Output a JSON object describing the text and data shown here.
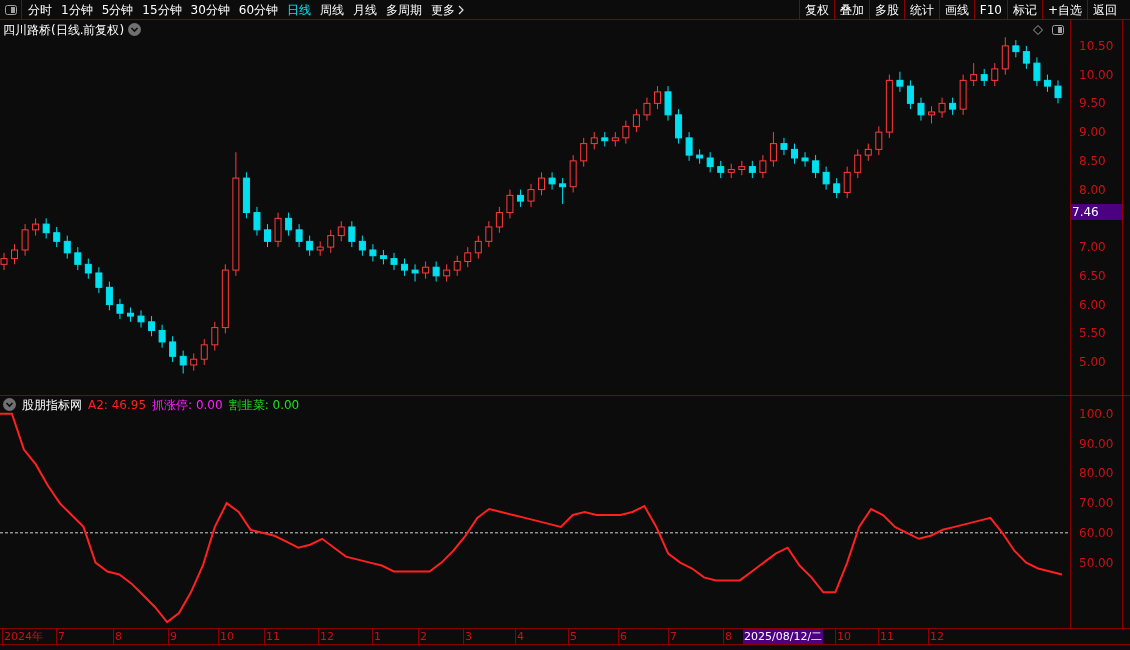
{
  "toolbar": {
    "periods": [
      {
        "label": "分时",
        "selected": false
      },
      {
        "label": "1分钟",
        "selected": false
      },
      {
        "label": "5分钟",
        "selected": false
      },
      {
        "label": "15分钟",
        "selected": false
      },
      {
        "label": "30分钟",
        "selected": false
      },
      {
        "label": "60分钟",
        "selected": false
      },
      {
        "label": "日线",
        "selected": true
      },
      {
        "label": "周线",
        "selected": false
      },
      {
        "label": "月线",
        "selected": false
      },
      {
        "label": "多周期",
        "selected": false
      },
      {
        "label": "更多",
        "selected": false
      }
    ],
    "buttons": [
      "复权",
      "叠加",
      "多股",
      "统计",
      "画线",
      "F10",
      "标记",
      "+自选",
      "返回"
    ]
  },
  "price_chart": {
    "title": "四川路桥(日线.前复权)",
    "current_price": "7.46",
    "chart_data": {
      "type": "candlestick",
      "ylim": [
        4.41,
        10.95
      ],
      "yticks": [
        {
          "value": 10.5,
          "label": "10.50"
        },
        {
          "value": 10,
          "label": "10.00"
        },
        {
          "value": 9.5,
          "label": "9.50"
        },
        {
          "value": 9,
          "label": "9.00"
        },
        {
          "value": 8.5,
          "label": "8.50"
        },
        {
          "value": 8,
          "label": "8.00"
        },
        {
          "value": 7,
          "label": "7.00"
        },
        {
          "value": 6.5,
          "label": "6.50"
        },
        {
          "value": 6,
          "label": "6.00"
        },
        {
          "value": 5.5,
          "label": "5.50"
        },
        {
          "value": 5,
          "label": "5.00"
        }
      ],
      "ohlc": [
        [
          6.7,
          6.9,
          6.6,
          6.8
        ],
        [
          6.8,
          7.05,
          6.7,
          6.95
        ],
        [
          6.95,
          7.4,
          6.85,
          7.3
        ],
        [
          7.3,
          7.5,
          7.2,
          7.4
        ],
        [
          7.4,
          7.5,
          7.15,
          7.25
        ],
        [
          7.25,
          7.35,
          7.0,
          7.1
        ],
        [
          7.1,
          7.2,
          6.8,
          6.9
        ],
        [
          6.9,
          7.0,
          6.6,
          6.7
        ],
        [
          6.7,
          6.8,
          6.45,
          6.55
        ],
        [
          6.55,
          6.65,
          6.2,
          6.3
        ],
        [
          6.3,
          6.4,
          5.9,
          6.0
        ],
        [
          6.0,
          6.1,
          5.75,
          5.85
        ],
        [
          5.85,
          5.95,
          5.7,
          5.8
        ],
        [
          5.8,
          5.9,
          5.6,
          5.7
        ],
        [
          5.7,
          5.8,
          5.45,
          5.55
        ],
        [
          5.55,
          5.65,
          5.25,
          5.35
        ],
        [
          5.35,
          5.45,
          5.0,
          5.1
        ],
        [
          5.1,
          5.2,
          4.8,
          4.95
        ],
        [
          4.95,
          5.15,
          4.85,
          5.05
        ],
        [
          5.05,
          5.4,
          4.95,
          5.3
        ],
        [
          5.3,
          5.7,
          5.2,
          5.6
        ],
        [
          5.6,
          6.7,
          5.5,
          6.6
        ],
        [
          6.6,
          8.65,
          6.5,
          8.2
        ],
        [
          8.2,
          8.3,
          7.5,
          7.6
        ],
        [
          7.6,
          7.7,
          7.2,
          7.3
        ],
        [
          7.3,
          7.4,
          7.0,
          7.1
        ],
        [
          7.1,
          7.6,
          7.0,
          7.5
        ],
        [
          7.5,
          7.6,
          7.2,
          7.3
        ],
        [
          7.3,
          7.4,
          7.0,
          7.1
        ],
        [
          7.1,
          7.2,
          6.85,
          6.95
        ],
        [
          6.95,
          7.1,
          6.85,
          7.0
        ],
        [
          7.0,
          7.3,
          6.9,
          7.2
        ],
        [
          7.2,
          7.45,
          7.1,
          7.35
        ],
        [
          7.35,
          7.45,
          7.0,
          7.1
        ],
        [
          7.1,
          7.2,
          6.85,
          6.95
        ],
        [
          6.95,
          7.05,
          6.75,
          6.85
        ],
        [
          6.85,
          6.95,
          6.7,
          6.8
        ],
        [
          6.8,
          6.9,
          6.6,
          6.7
        ],
        [
          6.7,
          6.8,
          6.5,
          6.6
        ],
        [
          6.6,
          6.7,
          6.4,
          6.55
        ],
        [
          6.55,
          6.75,
          6.45,
          6.65
        ],
        [
          6.65,
          6.75,
          6.4,
          6.5
        ],
        [
          6.5,
          6.7,
          6.4,
          6.6
        ],
        [
          6.6,
          6.85,
          6.5,
          6.75
        ],
        [
          6.75,
          7.0,
          6.65,
          6.9
        ],
        [
          6.9,
          7.2,
          6.8,
          7.1
        ],
        [
          7.1,
          7.45,
          7.0,
          7.35
        ],
        [
          7.35,
          7.7,
          7.25,
          7.6
        ],
        [
          7.6,
          8.0,
          7.5,
          7.9
        ],
        [
          7.9,
          8.0,
          7.7,
          7.8
        ],
        [
          7.8,
          8.1,
          7.7,
          8.0
        ],
        [
          8.0,
          8.3,
          7.9,
          8.2
        ],
        [
          8.2,
          8.3,
          8.0,
          8.1
        ],
        [
          8.1,
          8.2,
          7.75,
          8.05
        ],
        [
          8.05,
          8.6,
          7.95,
          8.5
        ],
        [
          8.5,
          8.9,
          8.4,
          8.8
        ],
        [
          8.8,
          9.0,
          8.7,
          8.9
        ],
        [
          8.9,
          9.0,
          8.75,
          8.85
        ],
        [
          8.85,
          9.0,
          8.75,
          8.9
        ],
        [
          8.9,
          9.2,
          8.8,
          9.1
        ],
        [
          9.1,
          9.4,
          9.0,
          9.3
        ],
        [
          9.3,
          9.6,
          9.2,
          9.5
        ],
        [
          9.5,
          9.8,
          9.4,
          9.7
        ],
        [
          9.7,
          9.8,
          9.2,
          9.3
        ],
        [
          9.3,
          9.4,
          8.8,
          8.9
        ],
        [
          8.9,
          9.0,
          8.5,
          8.6
        ],
        [
          8.6,
          8.7,
          8.45,
          8.55
        ],
        [
          8.55,
          8.65,
          8.3,
          8.4
        ],
        [
          8.4,
          8.5,
          8.2,
          8.3
        ],
        [
          8.3,
          8.45,
          8.2,
          8.35
        ],
        [
          8.35,
          8.5,
          8.25,
          8.4
        ],
        [
          8.4,
          8.5,
          8.2,
          8.3
        ],
        [
          8.3,
          8.6,
          8.2,
          8.5
        ],
        [
          8.5,
          9.0,
          8.4,
          8.8
        ],
        [
          8.8,
          8.9,
          8.6,
          8.7
        ],
        [
          8.7,
          8.8,
          8.45,
          8.55
        ],
        [
          8.55,
          8.65,
          8.4,
          8.5
        ],
        [
          8.5,
          8.6,
          8.2,
          8.3
        ],
        [
          8.3,
          8.4,
          8.0,
          8.1
        ],
        [
          8.1,
          8.2,
          7.85,
          7.95
        ],
        [
          7.95,
          8.4,
          7.85,
          8.3
        ],
        [
          8.3,
          8.7,
          8.2,
          8.6
        ],
        [
          8.6,
          8.8,
          8.5,
          8.7
        ],
        [
          8.7,
          9.1,
          8.6,
          9.0
        ],
        [
          9.0,
          10.0,
          8.9,
          9.9
        ],
        [
          9.9,
          10.05,
          9.7,
          9.8
        ],
        [
          9.8,
          9.9,
          9.4,
          9.5
        ],
        [
          9.5,
          9.6,
          9.2,
          9.3
        ],
        [
          9.3,
          9.45,
          9.15,
          9.35
        ],
        [
          9.35,
          9.6,
          9.25,
          9.5
        ],
        [
          9.5,
          9.6,
          9.3,
          9.4
        ],
        [
          9.4,
          10.0,
          9.3,
          9.9
        ],
        [
          9.9,
          10.2,
          9.8,
          10.0
        ],
        [
          10.0,
          10.1,
          9.8,
          9.9
        ],
        [
          9.9,
          10.2,
          9.8,
          10.1
        ],
        [
          10.1,
          10.65,
          10.0,
          10.5
        ],
        [
          10.5,
          10.6,
          10.3,
          10.4
        ],
        [
          10.4,
          10.5,
          10.1,
          10.2
        ],
        [
          10.2,
          10.3,
          9.8,
          9.9
        ],
        [
          9.9,
          10.0,
          9.7,
          9.8
        ],
        [
          9.8,
          9.9,
          9.5,
          9.6
        ]
      ]
    }
  },
  "indicator": {
    "name": "股朋指标网",
    "legend": [
      {
        "text": "A2: 46.95",
        "color": "#ff2020"
      },
      {
        "text": "抓涨停: 0.00",
        "color": "#ff20ff"
      },
      {
        "text": "割韭菜: 0.00",
        "color": "#20e020"
      }
    ],
    "chart_data": {
      "type": "line",
      "ylim": [
        28,
        106
      ],
      "yticks": [
        {
          "value": 100,
          "label": "100.0"
        },
        {
          "value": 90,
          "label": "90.00"
        },
        {
          "value": 80,
          "label": "80.00"
        },
        {
          "value": 70,
          "label": "70.00"
        },
        {
          "value": 60,
          "label": "60.00"
        },
        {
          "value": 50,
          "label": "50.00"
        }
      ],
      "series": [
        {
          "color": "#ff2020",
          "values": [
            100,
            100,
            88,
            83,
            76,
            70,
            66,
            62,
            50,
            47,
            46,
            43,
            39,
            35,
            30,
            33,
            40,
            49,
            62,
            70,
            67,
            61,
            60,
            59,
            57,
            55,
            56,
            58,
            55,
            52,
            51,
            50,
            49,
            47,
            47,
            47,
            47,
            50,
            54,
            59,
            65,
            68,
            67,
            66,
            65,
            64,
            63,
            62,
            66,
            67,
            66,
            66,
            66,
            67,
            69,
            62,
            53,
            50,
            48,
            45,
            44,
            44,
            44,
            47,
            50,
            53,
            55,
            49,
            45,
            40,
            40,
            50,
            62,
            68,
            66,
            62,
            60,
            58,
            59,
            61,
            62,
            63,
            64,
            65,
            60,
            54,
            50,
            48,
            47,
            46
          ]
        }
      ]
    }
  },
  "date_axis": {
    "labels": [
      "2024年",
      "7",
      "8",
      "9",
      "10",
      "11",
      "12",
      "1",
      "2",
      "3",
      "4",
      "5",
      "6",
      "7",
      "8",
      "10",
      "11",
      "12"
    ],
    "cursor_date": "2025/08/12/二"
  }
}
